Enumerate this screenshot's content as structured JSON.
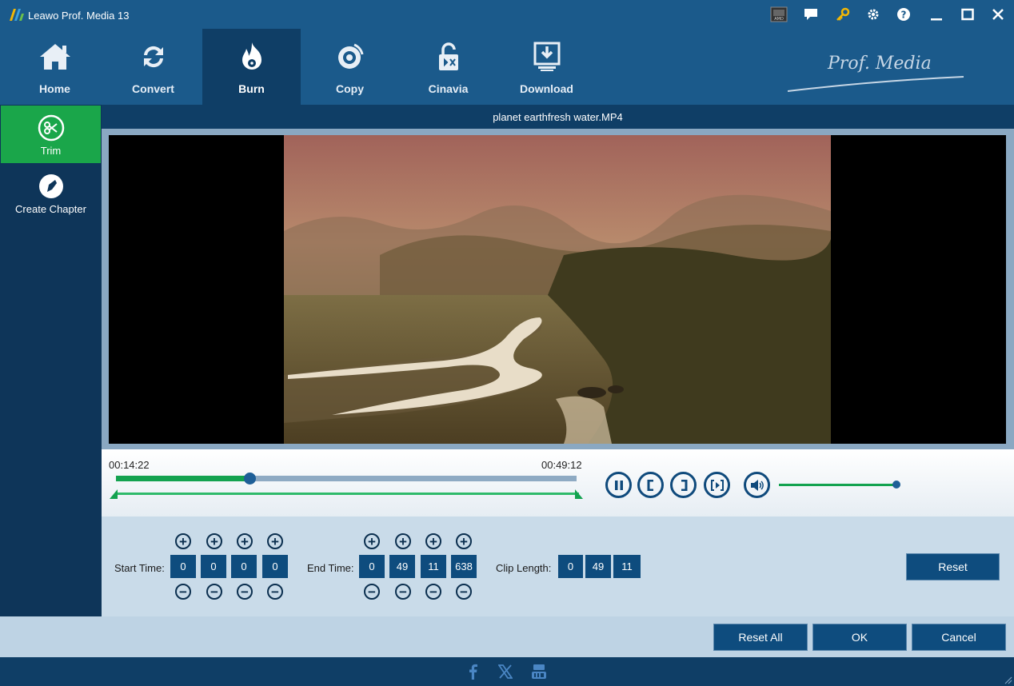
{
  "app": {
    "title": "Leawo Prof. Media 13"
  },
  "titlebar_icons": [
    "gpu-badge-icon",
    "chat-icon",
    "key-icon",
    "gear-icon",
    "help-icon",
    "minimize-icon",
    "maximize-icon",
    "close-icon"
  ],
  "nav": {
    "items": [
      {
        "label": "Home",
        "icon": "home-icon"
      },
      {
        "label": "Convert",
        "icon": "convert-icon"
      },
      {
        "label": "Burn",
        "icon": "burn-icon",
        "active": true
      },
      {
        "label": "Copy",
        "icon": "copy-icon"
      },
      {
        "label": "Cinavia",
        "icon": "cinavia-icon"
      },
      {
        "label": "Download",
        "icon": "download-icon"
      }
    ],
    "brand": "Prof. Media"
  },
  "sidebar": {
    "items": [
      {
        "label": "Trim",
        "icon": "scissors-icon",
        "active": true
      },
      {
        "label": "Create Chapter",
        "icon": "chapter-icon"
      }
    ]
  },
  "video": {
    "filename": "planet earthfresh water.MP4"
  },
  "playback": {
    "current_time": "00:14:22",
    "end_time": "00:49:12",
    "progress": 0.29,
    "volume": 1.0
  },
  "trim": {
    "start_label": "Start Time:",
    "start_values": [
      "0",
      "0",
      "0",
      "0"
    ],
    "end_label": "End Time:",
    "end_values": [
      "0",
      "49",
      "11",
      "638"
    ],
    "clip_label": "Clip Length:",
    "clip_values": [
      "0",
      "49",
      "11"
    ],
    "reset_label": "Reset"
  },
  "buttons": {
    "reset_all": "Reset All",
    "ok": "OK",
    "cancel": "Cancel"
  },
  "colors": {
    "primary": "#1b5a8b",
    "active_nav": "#0f3e66",
    "accent_green": "#1aa64a",
    "button_blue": "#0e4c7e"
  }
}
